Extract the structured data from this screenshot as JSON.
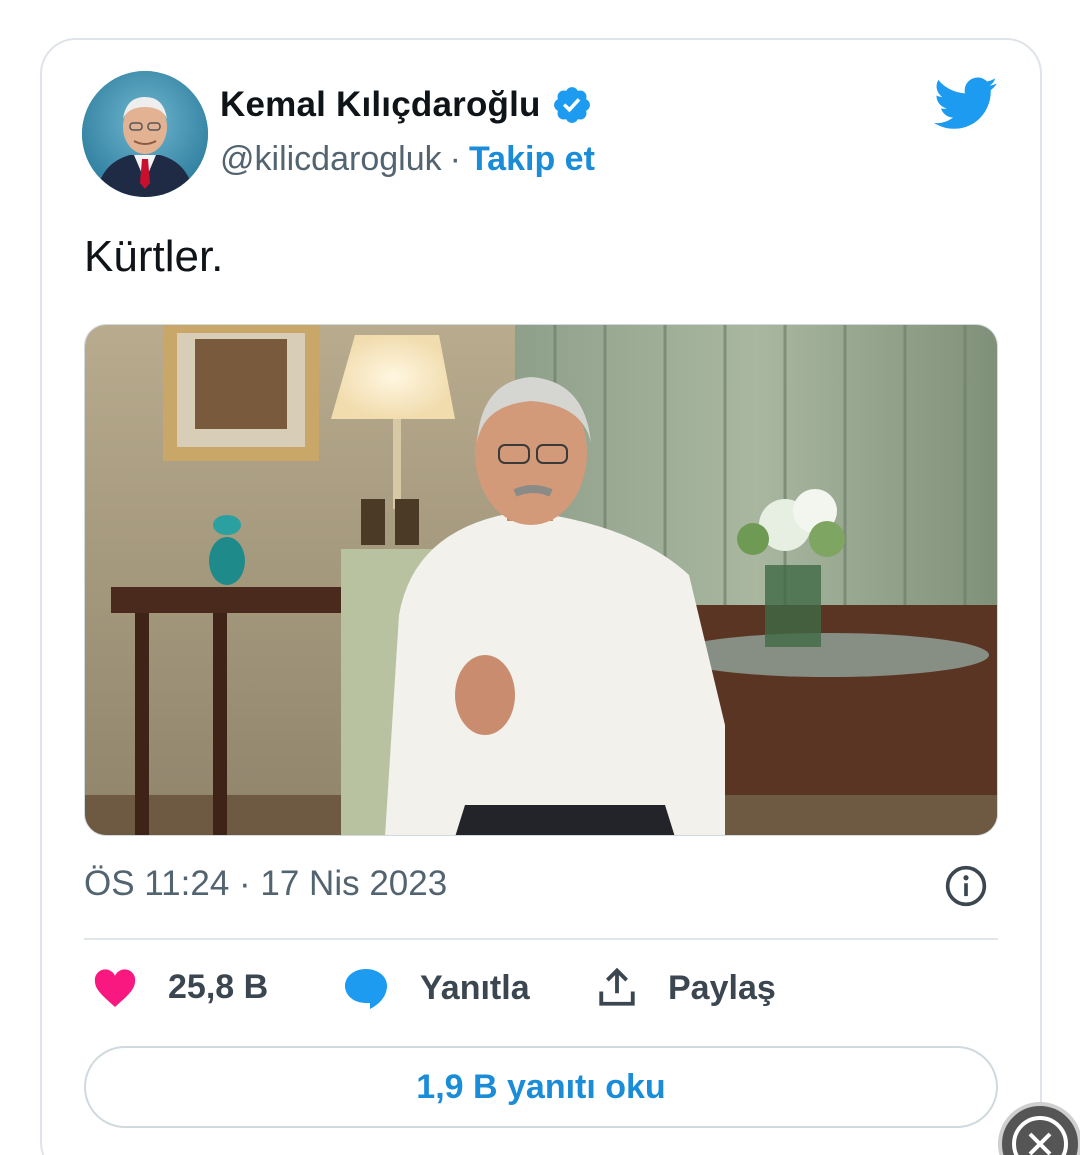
{
  "author": {
    "display_name": "Kemal Kılıçdaroğlu",
    "handle": "@kilicdarogluk",
    "separator": "·",
    "follow_label": "Takip et",
    "verified": true
  },
  "tweet": {
    "text": "Kürtler.",
    "timestamp": "ÖS 11:24 · 17 Nis 2023"
  },
  "actions": {
    "likes": "25,8 B",
    "reply_label": "Yanıtla",
    "share_label": "Paylaş"
  },
  "read_replies_label": "1,9 B yanıtı oku",
  "colors": {
    "accent": "#1a8cd8",
    "like": "#f91880",
    "twitter_blue": "#1d9bf0",
    "muted": "#536471"
  }
}
